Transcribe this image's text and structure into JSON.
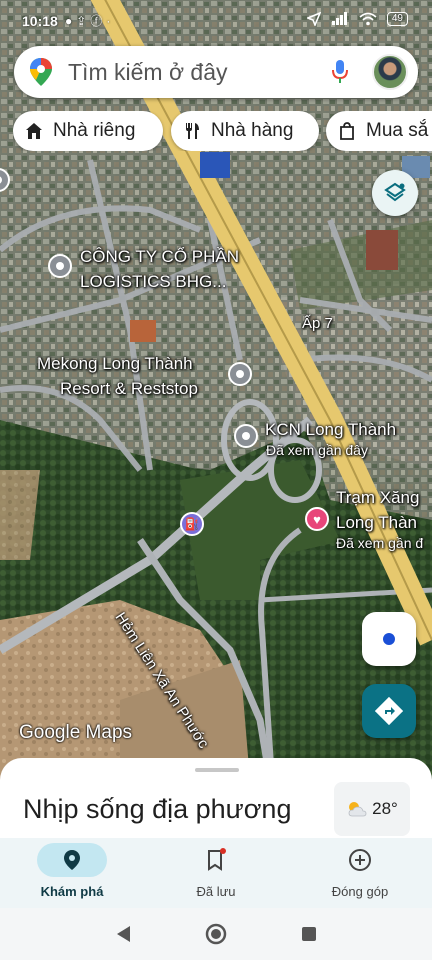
{
  "status_bar": {
    "time": "10:18",
    "battery": "49",
    "icons": [
      "chat-icon",
      "upload-icon",
      "facebook-icon",
      "more-dots-icon",
      "location-arrow-icon",
      "signal-icon",
      "wifi-icon",
      "battery-icon"
    ]
  },
  "search": {
    "placeholder": "Tìm kiếm ở đây"
  },
  "chips": [
    {
      "label": "Nhà riêng",
      "icon": "home-icon"
    },
    {
      "label": "Nhà hàng",
      "icon": "restaurant-icon"
    },
    {
      "label": "Mua sắ",
      "icon": "shopping-bag-icon"
    }
  ],
  "map": {
    "labels": {
      "company": "CÔNG TY CỔ PHẦN",
      "company2": "LOGISTICS BHG...",
      "resort1": "Mekong Long Thành",
      "resort2": "Resort & Reststop",
      "kcn": "KCN Long Thành",
      "kcn_sub": "Đã xem gần đây",
      "tram1": "Trạm Xăng",
      "tram2": "Long Thàn",
      "tram_sub": "Đã xem gần đ",
      "ap7": "Ấp 7",
      "hem": "Hẻm Liên Xã An Phước"
    },
    "watermark": "Google Maps",
    "colors": {
      "highway": "#e6c86e",
      "road": "#9aa0a6"
    }
  },
  "sheet": {
    "title": "Nhịp sống địa phương",
    "temperature": "28°",
    "weather_icon": "partly-cloudy-icon"
  },
  "bottom_nav": {
    "items": [
      {
        "label": "Khám phá",
        "icon": "location-pin-icon",
        "active": true
      },
      {
        "label": "Đã lưu",
        "icon": "bookmark-icon",
        "active": false
      },
      {
        "label": "Đóng góp",
        "icon": "add-circle-icon",
        "active": false
      }
    ]
  },
  "system_nav": [
    "back-icon",
    "home-circle-icon",
    "recents-icon"
  ]
}
